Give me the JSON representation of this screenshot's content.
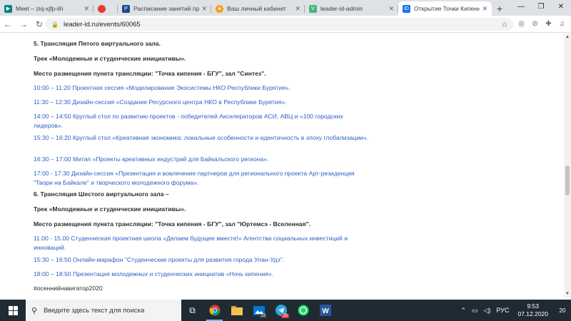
{
  "browser": {
    "tabs": [
      {
        "title": "Meet – ziq-xjfp-iih",
        "favicon_color": "#00897b"
      },
      {
        "title": "",
        "favicon_color": "#e53935"
      },
      {
        "title": "Расписание занятий преп",
        "favicon_color": "#1a4b8c"
      },
      {
        "title": "Ваш личный кабинет",
        "favicon_color": "#f4a21c"
      },
      {
        "title": "leader-id-admin",
        "favicon_color": "#41b883"
      },
      {
        "title": "Открытие Точки Кипения",
        "favicon_color": "#1a73e8"
      }
    ],
    "url": "leader-id.ru/events/60065"
  },
  "content": {
    "items": [
      {
        "text": "5. Трансляция Пятого виртуального зала.",
        "type": "head"
      },
      {
        "text": "Трек «Молодежные и студенческие инициативы».",
        "type": "head"
      },
      {
        "text": "Место размещения пункта трансляции: \"Точка кипения - БГУ\", зал \"Синтез\".",
        "type": "head"
      },
      {
        "text": "10:00 – 11:20   Проектная сессия «Моделирование Экосистемы НКО Республики Бурятия».",
        "type": "link"
      },
      {
        "text": "11:30 – 12:30   Дизайн-сессия «Создание Ресурсного центра НКО в Республике Бурятия».",
        "type": "link"
      },
      {
        "text": "14:00 – 14:50 Круглый стол по развитию проектов - победителей Акселераторов АСИ, АВЦ и «100 городских лидеров».",
        "type": "link"
      },
      {
        "text": "15:30 – 16:20   Круглый стол «Креативная экономика: локальные особенности и идентичность в эпоху глобализации».",
        "type": "link"
      },
      {
        "text": "16:30 – 17:00   Митап «Проекты креативных индустрий для Байкальского региона».",
        "type": "link"
      },
      {
        "text": "17:00 - 17:30 Дизайн-сессия «Презентация и вовлечение партнеров для регионального проекта Арт-резиденция \"Твори на Байкале\" и творческого молодежного форума».",
        "type": "link"
      },
      {
        "text": "6. Трансляция Шестого виртуального зала –",
        "type": "head"
      },
      {
        "text": "Трек «Молодежные и студенческие инициативы».",
        "type": "head"
      },
      {
        "text": "Место размещения пункта трансляции: \"Точка кипения - БГУ\", зал \"Юртемсэ - Вселенная\".",
        "type": "head"
      },
      {
        "text": "11.00 - 15.00 Студенческая проектная школа «Делаем будущее вместе!» Агентства социальных инвестиций и инноваций.",
        "type": "link"
      },
      {
        "text": "15:30 – 16:50 Онлайн-марафон \"Студенческие проекты для развития города Улан-Удэ\".",
        "type": "link"
      },
      {
        "text": "18:00 – 18:50 Презентация молодежных и студенческих инициатив «Ночь кипения».",
        "type": "link"
      },
      {
        "text": "#осеннийнавигатор2020",
        "type": "tag"
      }
    ]
  },
  "taskbar": {
    "search_placeholder": "Введите здесь текст для поиска",
    "badge_33": "33",
    "badge_25": "25",
    "language": "РУС",
    "time": "9:53",
    "date": "07.12.2020",
    "notifications_count": "20"
  }
}
